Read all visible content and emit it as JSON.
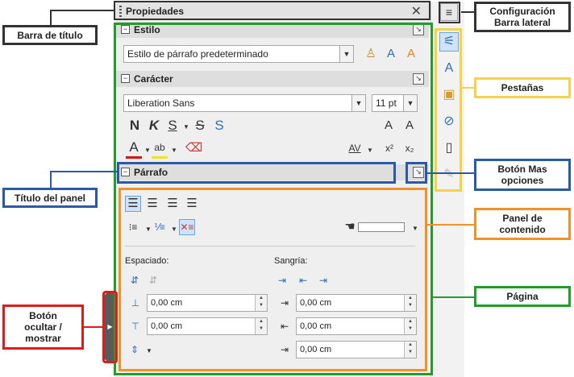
{
  "deck": {
    "title": "Propiedades",
    "close_glyph": "✕"
  },
  "estilo": {
    "title": "Estilo",
    "paragraph_style": "Estilo de párrafo predeterminado"
  },
  "caracter": {
    "title": "Carácter",
    "font_name": "Liberation Sans",
    "font_size": "11 pt",
    "bold": "N",
    "italic": "K",
    "underline": "S",
    "strike": "S",
    "shadow": "S",
    "color": "A",
    "highlight": "ab",
    "grow": "A",
    "shrink": "A",
    "spacing": "AV",
    "superscript": "x²",
    "subscript": "x₂"
  },
  "parrafo": {
    "title": "Párrafo",
    "espaciado_label": "Espaciado:",
    "sangria_label": "Sangría:",
    "above_spacing": "0,00 cm",
    "below_spacing": "0,00 cm",
    "indent_before": "0,00 cm",
    "indent_after": "0,00 cm",
    "first_line": "0,00 cm"
  },
  "annotations": {
    "barra_titulo": "Barra de título",
    "config_barra": "Configuración\nBarra lateral",
    "pestanas": "Pestañas",
    "boton_mas": "Botón Mas\nopciones",
    "titulo_panel": "Título del panel",
    "panel_contenido": "Panel de\ncontenido",
    "pagina": "Página",
    "boton_ocultar": "Botón\nocultar /\nmostrar"
  },
  "colors": {
    "green": "#1f9e2a",
    "blue": "#2a5aa6",
    "orange": "#f0922a",
    "yellow": "#f5d24a",
    "red": "#e01b1b",
    "dark": "#333333"
  }
}
